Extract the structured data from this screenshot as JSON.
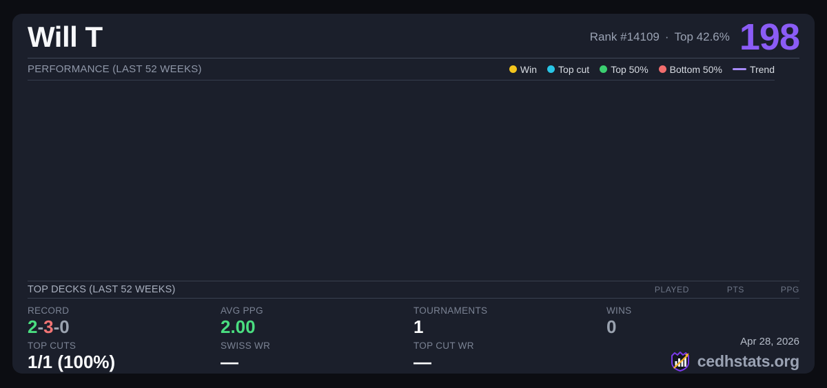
{
  "header": {
    "player_name": "Will T",
    "rank_text": "Rank #14109",
    "separator": "·",
    "top_percent": "Top 42.6%",
    "points": "198"
  },
  "performance": {
    "title": "PERFORMANCE (LAST 52 WEEKS)",
    "legend": [
      {
        "label": "Win",
        "color": "#f3c51d"
      },
      {
        "label": "Top cut",
        "color": "#29c5e6"
      },
      {
        "label": "Top 50%",
        "color": "#3bcf70"
      },
      {
        "label": "Bottom 50%",
        "color": "#f26d6d"
      },
      {
        "label": "Trend",
        "color": "#a78bfa"
      }
    ]
  },
  "chart_data": {
    "type": "scatter",
    "title": "PERFORMANCE (LAST 52 WEEKS)",
    "points": [],
    "legend": [
      "Win",
      "Top cut",
      "Top 50%",
      "Bottom 50%",
      "Trend"
    ],
    "legend_position": "top-right",
    "grid": false
  },
  "top_decks": {
    "title": "TOP DECKS (LAST 52 WEEKS)",
    "columns": [
      "PLAYED",
      "PTS",
      "PPG"
    ],
    "rows": []
  },
  "stats": {
    "record": {
      "label": "RECORD",
      "wins": "2",
      "losses": "3",
      "draws": "0",
      "sep": "-"
    },
    "top_cuts": {
      "label": "TOP CUTS",
      "value": "1/1 (100%)"
    },
    "avg_ppg": {
      "label": "AVG PPG",
      "value": "2.00"
    },
    "swiss_wr": {
      "label": "SWISS WR",
      "value": "—"
    },
    "tournaments": {
      "label": "TOURNAMENTS",
      "value": "1"
    },
    "top_cut_wr": {
      "label": "TOP CUT WR",
      "value": "—"
    },
    "wins": {
      "label": "WINS",
      "value": "0"
    }
  },
  "footer": {
    "date": "Apr 28, 2026",
    "site": "cedhstats.org"
  },
  "colors": {
    "accent_purple": "#8b5cf6",
    "trend_purple": "#a78bfa",
    "win_yellow": "#f3c51d",
    "top_cut_cyan": "#29c5e6",
    "top50_green": "#3bcf70",
    "bottom50_red": "#f26d6d",
    "value_green": "#4ade80",
    "value_red": "#f17474",
    "value_gray": "#9aa2af",
    "card_bg": "#1b1f2b",
    "page_bg": "#0c0d12"
  }
}
